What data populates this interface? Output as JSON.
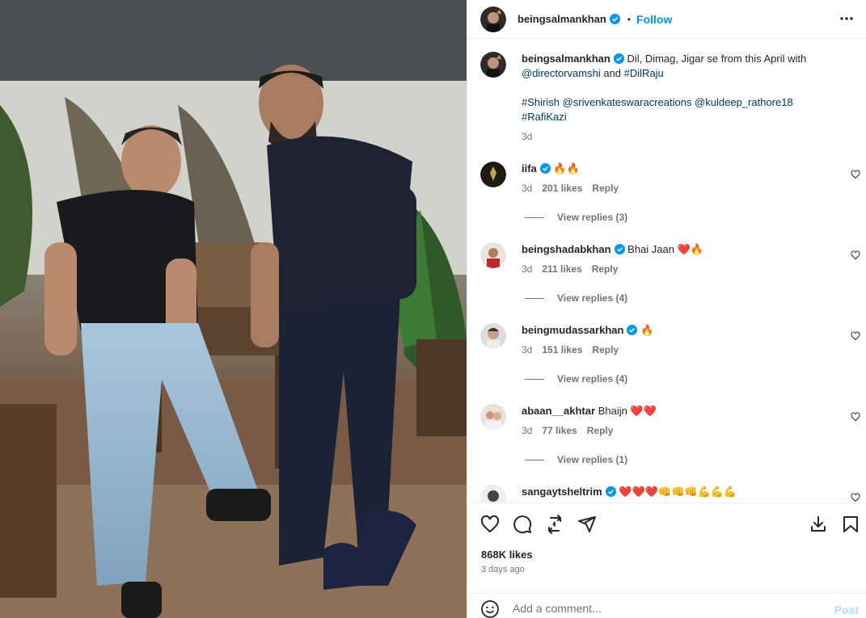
{
  "post": {
    "username": "beingsalmankhan",
    "follow_label": "Follow",
    "dot": "•",
    "caption_text": "Dil, Dimag, Jigar se from this April with",
    "caption_mention_1": "@directorvamshi",
    "caption_and": " and ",
    "caption_tag_1": "#DilRaju",
    "caption_line2": "#Shirish @srivenkateswaracreations @kuldeep_rathore18",
    "caption_line3": "#RafiKazi",
    "caption_time": "3d"
  },
  "comments": [
    {
      "user": "iifa",
      "text": "🔥🔥",
      "time": "3d",
      "likes": "201 likes",
      "reply": "Reply",
      "replies": "View replies (3)"
    },
    {
      "user": "beingshadabkhan",
      "text": "Bhai Jaan ❤️🔥",
      "time": "3d",
      "likes": "211 likes",
      "reply": "Reply",
      "replies": "View replies (4)"
    },
    {
      "user": "beingmudassarkhan",
      "text": "🔥",
      "time": "3d",
      "likes": "151 likes",
      "reply": "Reply",
      "replies": "View replies (4)"
    },
    {
      "user": "abaan__akhtar",
      "text": "Bhaijn ❤️❤️",
      "time": "3d",
      "likes": "77 likes",
      "reply": "Reply",
      "replies": "View replies (1)"
    },
    {
      "user": "sangaytsheltrim",
      "text": "❤️❤️❤️👊👊👊💪💪💪"
    }
  ],
  "footer": {
    "likes": "868K likes",
    "time_ago": "3 days ago",
    "comment_placeholder": "Add a comment...",
    "post_label": "Post"
  },
  "colors": {
    "accent": "#0095f6",
    "link": "#00376b",
    "muted": "#737373",
    "verified": "#0095f6"
  }
}
